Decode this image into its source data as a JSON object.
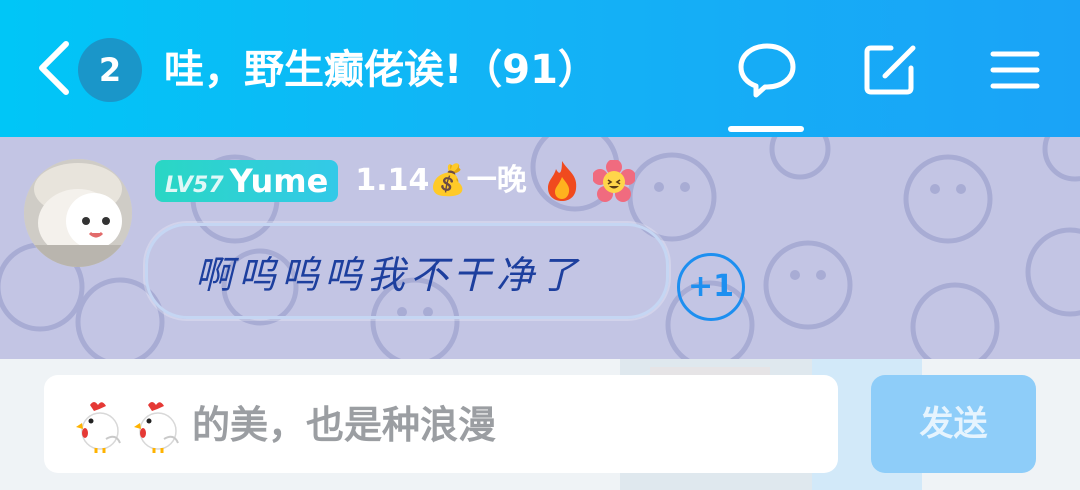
{
  "header": {
    "unread_count": "2",
    "title": "哇，野生癫佬诶!（91）",
    "icons": [
      "back-arrow-icon",
      "chat-bubble-icon",
      "edit-icon",
      "menu-icon"
    ]
  },
  "message": {
    "level": "LV57",
    "username": "Yume",
    "signature": "1.14💰一晚",
    "text": "啊呜呜呜我不干净了",
    "plus_one": "+1"
  },
  "input": {
    "text": "的美，也是种浪漫",
    "send_label": "发送"
  },
  "colors": {
    "header_start": "#00c6f7",
    "header_end": "#1aa3f7",
    "message_bg": "#c3c5e4",
    "bubble_text": "#1d3f9e",
    "send_button": "#8ecdf9"
  }
}
